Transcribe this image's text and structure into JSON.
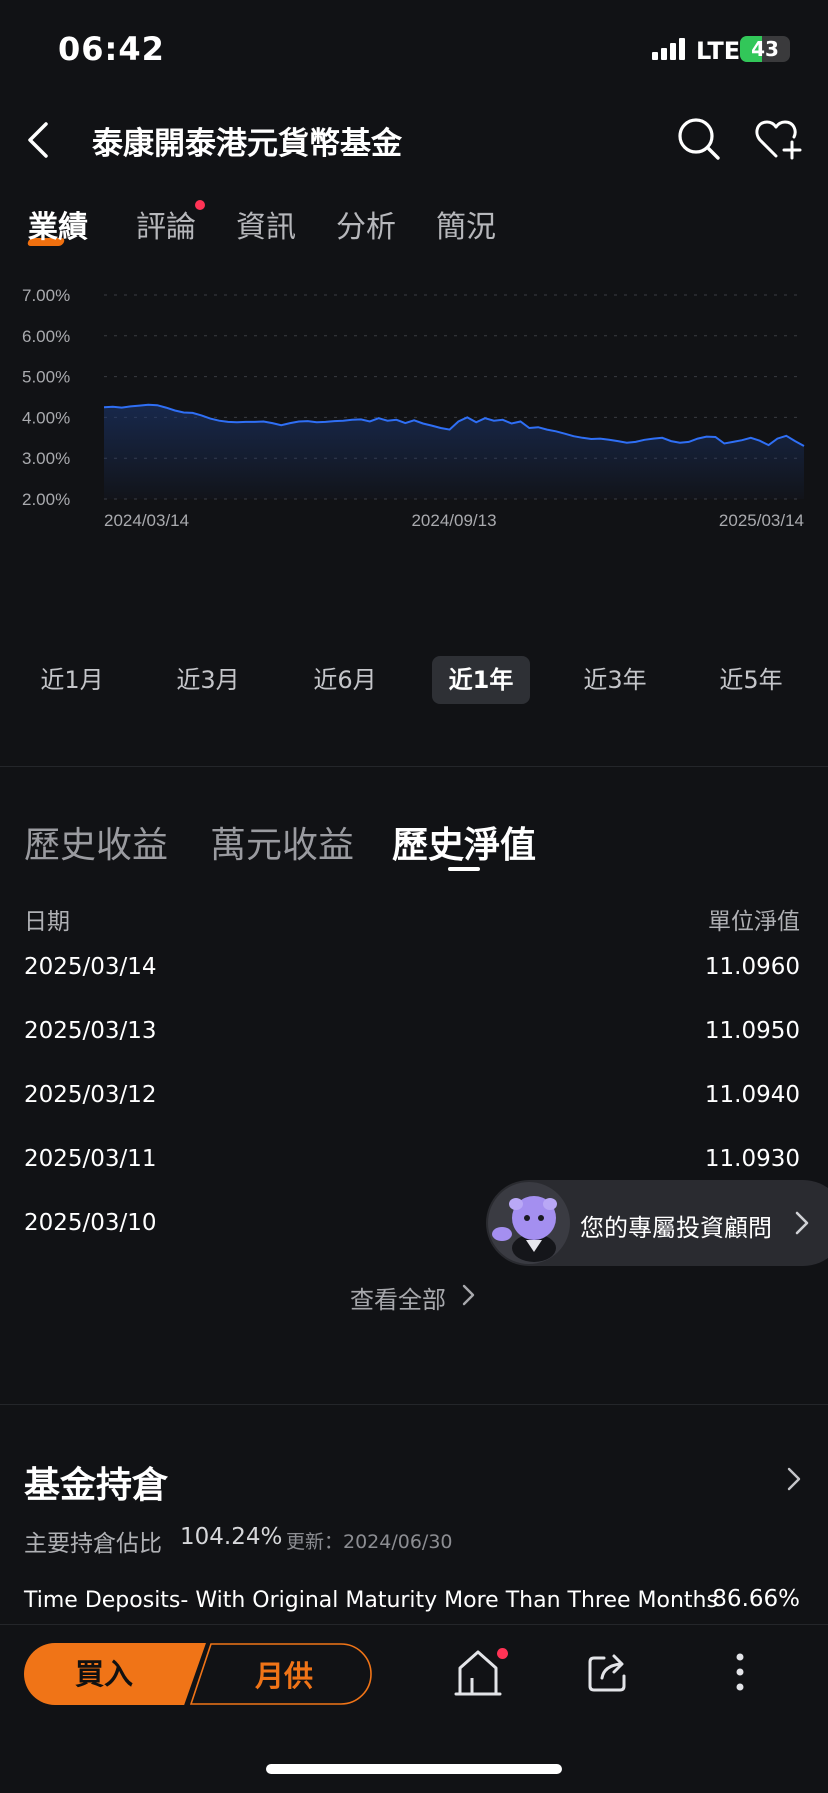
{
  "status_bar": {
    "time": "06:42",
    "network": "LTE",
    "battery": "43",
    "battery_level": 0.43
  },
  "header": {
    "title": "泰康開泰港元貨幣基金",
    "icons": [
      "back-icon",
      "search-icon",
      "heart-plus-icon"
    ]
  },
  "tabs": [
    {
      "label": "業績",
      "active": true
    },
    {
      "label": "評論",
      "has_dot": true
    },
    {
      "label": "資訊"
    },
    {
      "label": "分析"
    },
    {
      "label": "簡況"
    }
  ],
  "chart_data": {
    "type": "area",
    "y_tick_labels": [
      "7.00%",
      "6.00%",
      "5.00%",
      "4.00%",
      "3.00%",
      "2.00%"
    ],
    "ylim": [
      2.0,
      7.0
    ],
    "x_tick_labels": [
      "2024/03/14",
      "2024/09/13",
      "2025/03/14"
    ],
    "grid": true,
    "line_color": "#2f6ff5",
    "series": [
      {
        "values": [
          4.25,
          4.26,
          4.24,
          4.27,
          4.29,
          4.31,
          4.3,
          4.24,
          4.17,
          4.12,
          4.11,
          4.05,
          3.97,
          3.92,
          3.89,
          3.88,
          3.89,
          3.89,
          3.9,
          3.86,
          3.81,
          3.86,
          3.9,
          3.91,
          3.88,
          3.89,
          3.91,
          3.92,
          3.94,
          3.95,
          3.9,
          3.98,
          3.92,
          3.94,
          3.86,
          3.93,
          3.85,
          3.8,
          3.74,
          3.7,
          3.9,
          4.0,
          3.88,
          3.98,
          3.92,
          3.94,
          3.85,
          3.9,
          3.74,
          3.76,
          3.7,
          3.66,
          3.6,
          3.54,
          3.5,
          3.47,
          3.48,
          3.45,
          3.42,
          3.38,
          3.4,
          3.45,
          3.48,
          3.5,
          3.42,
          3.38,
          3.4,
          3.48,
          3.53,
          3.52,
          3.36,
          3.4,
          3.44,
          3.5,
          3.43,
          3.32,
          3.48,
          3.55,
          3.42,
          3.3
        ]
      }
    ]
  },
  "periods": [
    {
      "label": "近1月"
    },
    {
      "label": "近3月"
    },
    {
      "label": "近6月"
    },
    {
      "label": "近1年",
      "active": true
    },
    {
      "label": "近3年"
    },
    {
      "label": "近5年"
    }
  ],
  "section_tabs": [
    {
      "label": "歷史收益"
    },
    {
      "label": "萬元收益"
    },
    {
      "label": "歷史淨值",
      "active": true
    }
  ],
  "nav_table": {
    "headers": {
      "date": "日期",
      "value": "單位淨值"
    },
    "rows": [
      {
        "date": "2025/03/14",
        "value": "11.0960"
      },
      {
        "date": "2025/03/13",
        "value": "11.0950"
      },
      {
        "date": "2025/03/12",
        "value": "11.0940"
      },
      {
        "date": "2025/03/11",
        "value": "11.0930"
      },
      {
        "date": "2025/03/10",
        "value": ""
      }
    ],
    "view_all": "查看全部"
  },
  "advisor": {
    "label": "您的專屬投資顧問"
  },
  "holdings": {
    "title": "基金持倉",
    "ratio_label": "主要持倉佔比",
    "ratio": "104.24%",
    "updated": "更新：2024/06/30",
    "items": [
      {
        "name": "Time Deposits- With Original Maturity More Than Three Months",
        "pct": "86.66%"
      }
    ]
  },
  "bottom_bar": {
    "buy": "買入",
    "monthly": "月供"
  },
  "colors": {
    "accent": "#f07417",
    "background": "#111215",
    "notification": "#ff3355",
    "chart_line": "#2f6ff5"
  }
}
